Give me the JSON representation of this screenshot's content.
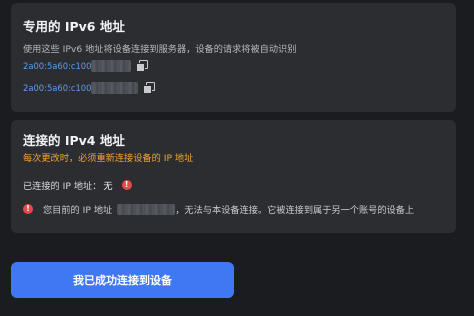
{
  "ipv6": {
    "title": "专用的 IPv6 地址",
    "description": "使用这些 IPv6 地址将设备连接到服务器，设备的请求将被自动识别",
    "addresses": [
      {
        "prefix": "2a00:5a60:c100"
      },
      {
        "prefix": "2a00:5a60:c100"
      }
    ],
    "copy_icon": "copy-icon"
  },
  "ipv4": {
    "title": "连接的 IPv4 地址",
    "warning": "每次更改时，必须重新连接设备的 IP 地址",
    "status_label": "已连接的 IP 地址：",
    "status_value": "无",
    "notice_prefix": "您目前的 IP 地址",
    "notice_suffix": "，无法与本设备连接。它被连接到属于另一个账号的设备上",
    "error_icon": "error-icon",
    "colors": {
      "warning": "#f3a531",
      "error": "#e24b4b"
    }
  },
  "connect_button": {
    "label": "我已成功连接到设备"
  },
  "colors": {
    "accent": "#3f78f2",
    "link": "#5e9cf0",
    "card": "#2c2d31",
    "background": "#1b1c1f"
  }
}
